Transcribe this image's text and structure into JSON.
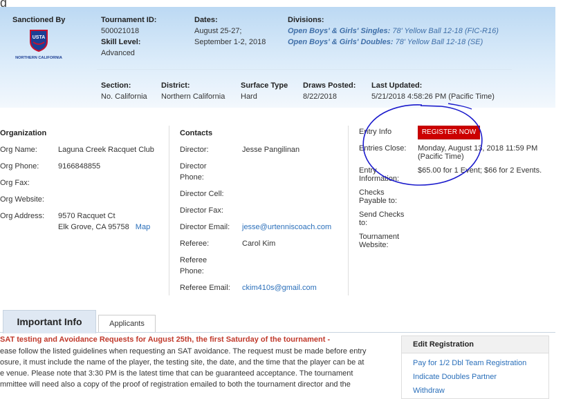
{
  "header": {
    "sanctioned_label": "Sanctioned By",
    "logo_top": "USTA",
    "logo_bottom": "NORTHERN CALIFORNIA",
    "tid_label": "Tournament ID:",
    "tid_value": "500021018",
    "skill_label": "Skill Level:",
    "skill_value": "Advanced",
    "dates_label": "Dates:",
    "dates_line1": "August 25-27;",
    "dates_line2": "September 1-2, 2018",
    "divisions_label": "Divisions:",
    "div1_link": "Open Boys' & Girls' Singles:",
    "div1_rest": "78' Yellow Ball 12-18",
    "div1_code": "(FIC-R16)",
    "div2_link": "Open Boys' & Girls' Doubles:",
    "div2_rest": "78' Yellow Ball 12-18",
    "div2_code": "(SE)",
    "section_label": "Section:",
    "section_value": "No. California",
    "district_label": "District:",
    "district_value": "Northern California",
    "surface_label": "Surface Type",
    "surface_value": "Hard",
    "draws_label": "Draws Posted:",
    "draws_value": "8/22/2018",
    "updated_label": "Last Updated:",
    "updated_value": "5/21/2018 4:58:26 PM (Pacific Time)"
  },
  "organization": {
    "title": "Organization",
    "name_label": "Org Name:",
    "name_value": "Laguna Creek Racquet Club",
    "phone_label": "Org Phone:",
    "phone_value": "9166848855",
    "fax_label": "Org Fax:",
    "website_label": "Org Website:",
    "address_label": "Org Address:",
    "address_line1": "9570 Racquet Ct",
    "address_line2": "Elk Grove, CA 95758",
    "map_link": "Map"
  },
  "contacts": {
    "title": "Contacts",
    "director_label": "Director:",
    "director_value": "Jesse Pangilinan",
    "director_phone_1": "Director",
    "director_phone_2": "Phone:",
    "director_cell": "Director Cell:",
    "director_fax": "Director Fax:",
    "director_email_label": "Director Email:",
    "director_email_value": "jesse@urtenniscoach.com",
    "referee_label": "Referee:",
    "referee_value": "Carol Kim",
    "referee_phone_1": "Referee",
    "referee_phone_2": "Phone:",
    "referee_email_label": "Referee Email:",
    "referee_email_value": "ckim410s@gmail.com"
  },
  "entry": {
    "title": "Entry Info",
    "register_button": "REGISTER NOW",
    "close_label": "Entries Close:",
    "close_value_1": "Monday, August 13, 2018 11:59 PM",
    "close_value_2": "(Pacific Time)",
    "info_label_1": "Entry",
    "info_label_2": "Information:",
    "info_value": "$65.00 for 1 Event; $66 for 2 Events.",
    "checks_label_1": "Checks",
    "checks_label_2": "Payable to:",
    "send_label_1": "Send Checks",
    "send_label_2": "to:",
    "website_label_1": "Tournament",
    "website_label_2": "Website:"
  },
  "tabs": {
    "active": "Important Info",
    "other": "Applicants"
  },
  "notice": {
    "title": "SAT testing and Avoidance Requests for August 25th, the first Saturday of the tournament -",
    "line1": "ease follow the listed guidelines when requesting an SAT avoidance. The request must be made before entry",
    "line2": "osure, it must include the name of the player, the testing site, the date, and the time that the player can be at",
    "line3": "e venue. Please note that 3:30 PM is the latest time that can be guaranteed acceptance. The tournament",
    "line4": "mmittee will need also a copy of the proof of registration emailed to both the tournament director and the"
  },
  "sidebar": {
    "title": "Edit Registration",
    "items": [
      "Pay for 1/2 Dbl Team Registration",
      "Indicate Doubles Partner",
      "Withdraw"
    ]
  },
  "colors": {
    "accent_red": "#cc0000",
    "link_blue": "#2a6fba",
    "annotation_circle": "#1a1acc"
  }
}
